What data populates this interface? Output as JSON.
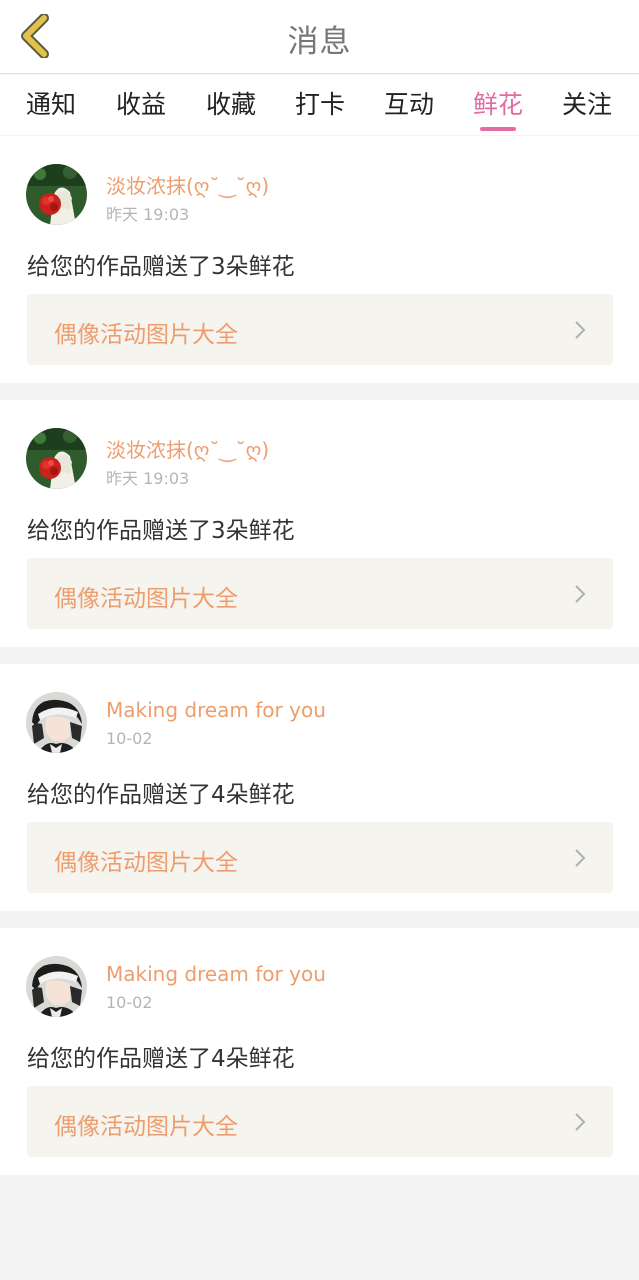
{
  "header": {
    "title": "消息",
    "back_icon": "chevron-left-icon",
    "back_color": "#e2c24f"
  },
  "tabs": [
    {
      "label": "通知",
      "active": false
    },
    {
      "label": "收益",
      "active": false
    },
    {
      "label": "收藏",
      "active": false
    },
    {
      "label": "打卡",
      "active": false
    },
    {
      "label": "互动",
      "active": false
    },
    {
      "label": "鲜花",
      "active": true
    },
    {
      "label": "关注",
      "active": false
    }
  ],
  "colors": {
    "accent": "#e46aa3",
    "username": "#ec9e6e",
    "link_bg": "#f5f4ef"
  },
  "messages": [
    {
      "username": "淡妆浓抹(ღ˘‿˘ღ)",
      "time": "昨天 19:03",
      "text": "给您的作品赠送了3朵鲜花",
      "work_title": "偶像活动图片大全",
      "avatar": "rose-avatar"
    },
    {
      "username": "淡妆浓抹(ღ˘‿˘ღ)",
      "time": "昨天 19:03",
      "text": "给您的作品赠送了3朵鲜花",
      "work_title": "偶像活动图片大全",
      "avatar": "rose-avatar"
    },
    {
      "username": "Making dream for you",
      "time": "10-02",
      "text": "给您的作品赠送了4朵鲜花",
      "work_title": "偶像活动图片大全",
      "avatar": "anime-boy-avatar"
    },
    {
      "username": "Making dream for you",
      "time": "10-02",
      "text": "给您的作品赠送了4朵鲜花",
      "work_title": "偶像活动图片大全",
      "avatar": "anime-boy-avatar"
    }
  ]
}
